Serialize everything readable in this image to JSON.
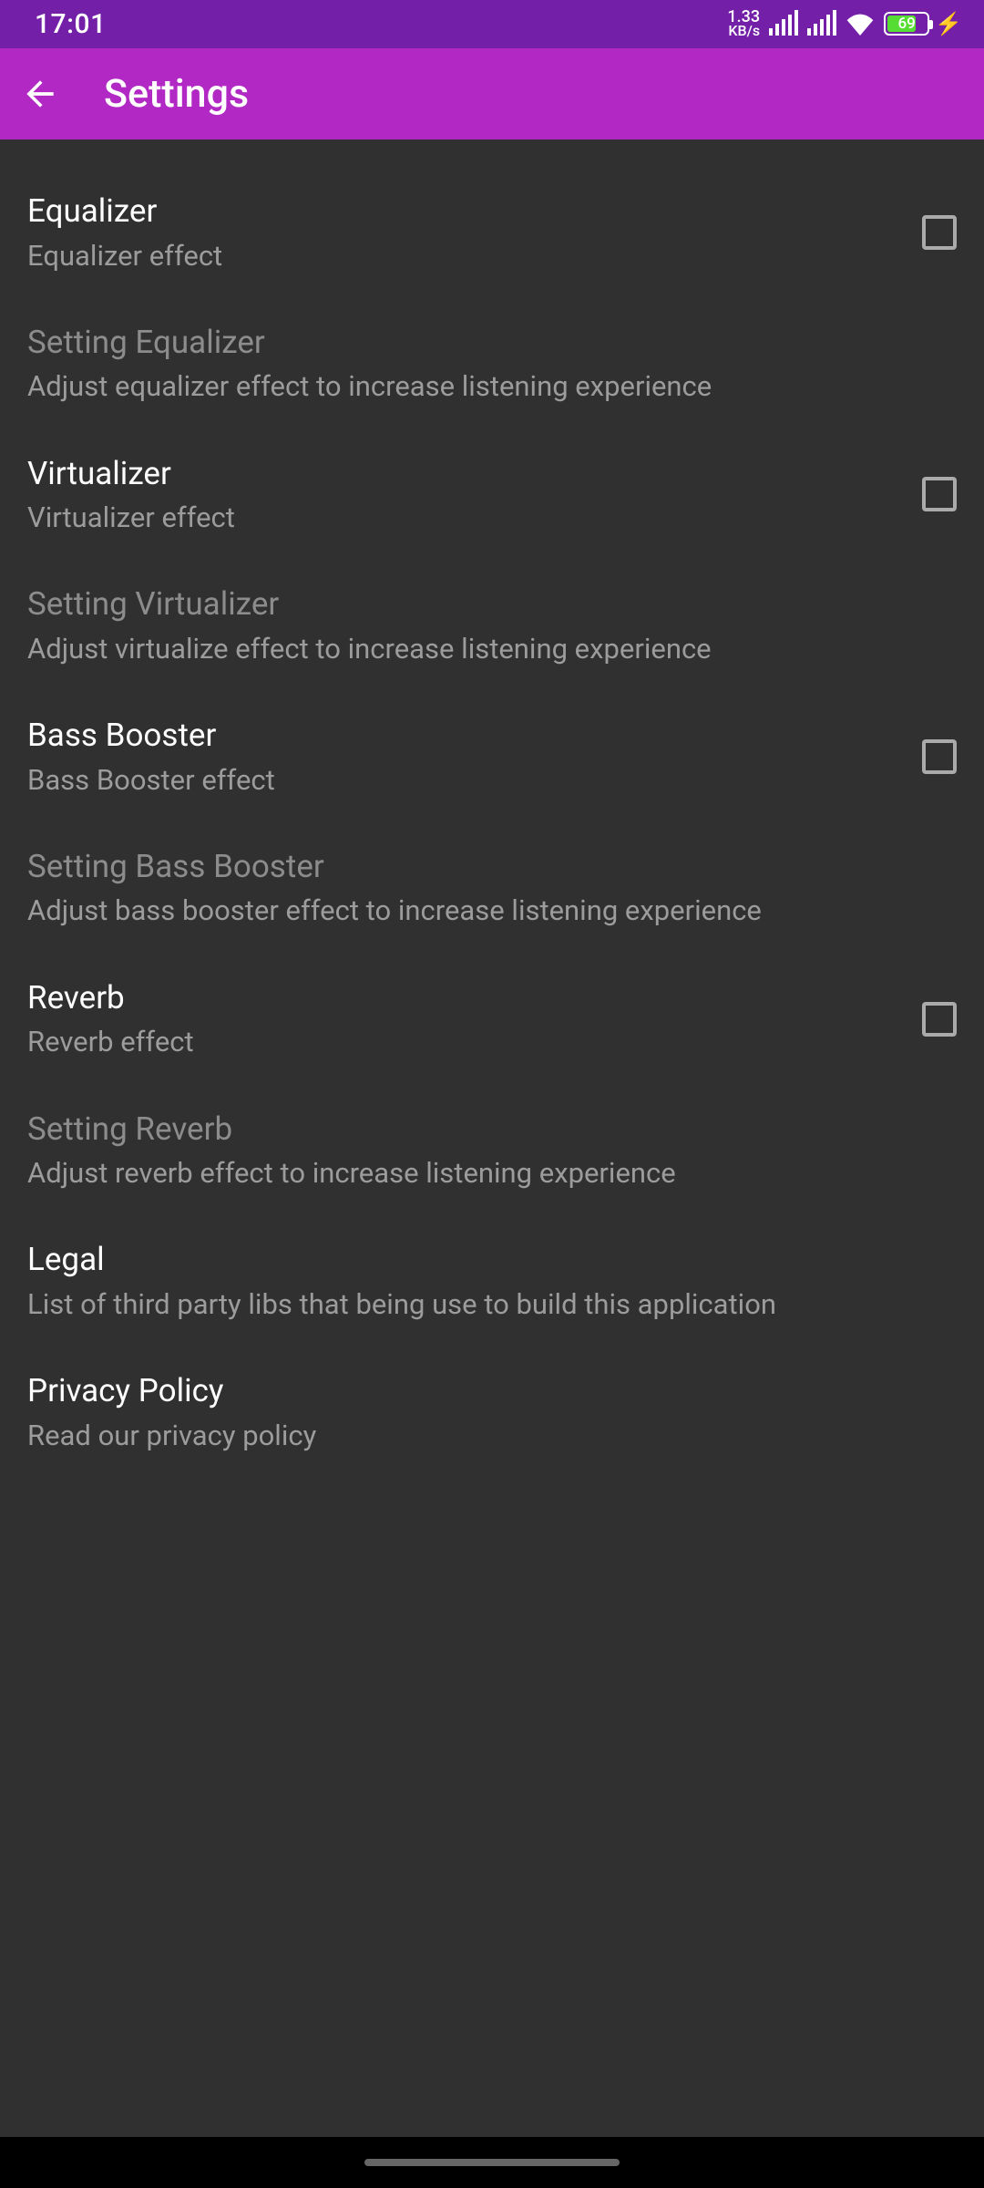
{
  "status": {
    "time": "17:01",
    "net_rate": "1.33",
    "net_unit": "KB/s",
    "battery_pct": "69"
  },
  "appbar": {
    "title": "Settings"
  },
  "items": [
    {
      "title": "Equalizer",
      "sub": "Equalizer effect",
      "checkbox": true,
      "muted": false
    },
    {
      "title": "Setting Equalizer",
      "sub": "Adjust equalizer effect to increase listening experience",
      "checkbox": false,
      "muted": true
    },
    {
      "title": "Virtualizer",
      "sub": "Virtualizer effect",
      "checkbox": true,
      "muted": false
    },
    {
      "title": "Setting Virtualizer",
      "sub": "Adjust virtualize effect to increase listening experience",
      "checkbox": false,
      "muted": true
    },
    {
      "title": "Bass Booster",
      "sub": "Bass Booster effect",
      "checkbox": true,
      "muted": false
    },
    {
      "title": "Setting Bass Booster",
      "sub": "Adjust bass booster effect to increase listening experience",
      "checkbox": false,
      "muted": true
    },
    {
      "title": "Reverb",
      "sub": "Reverb effect",
      "checkbox": true,
      "muted": false
    },
    {
      "title": "Setting Reverb",
      "sub": "Adjust reverb effect to increase listening experience",
      "checkbox": false,
      "muted": true
    },
    {
      "title": "Legal",
      "sub": "List of third party libs that being use to build this application",
      "checkbox": false,
      "muted": false
    },
    {
      "title": "Privacy Policy",
      "sub": "Read our privacy policy",
      "checkbox": false,
      "muted": false
    }
  ]
}
